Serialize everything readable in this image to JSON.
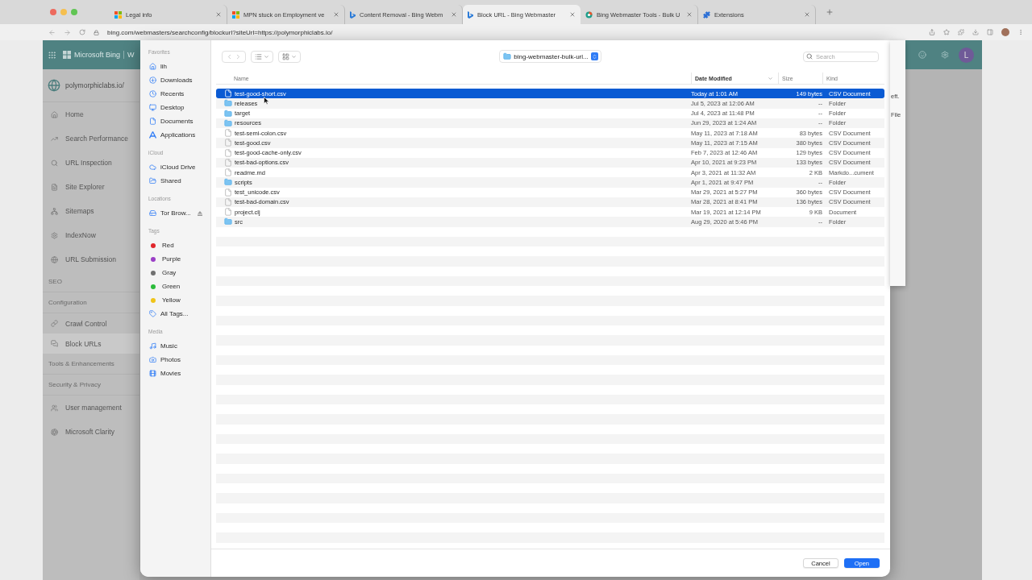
{
  "browser": {
    "tabs": [
      {
        "title": "Legal info",
        "kind": "microsoft",
        "selected": false
      },
      {
        "title": "MPN stuck on Employment ve",
        "kind": "microsoft",
        "selected": false
      },
      {
        "title": "Content Removal - Bing Webm",
        "kind": "bing",
        "selected": false
      },
      {
        "title": "Block URL - Bing Webmaster",
        "kind": "bing",
        "selected": true
      },
      {
        "title": "Bing Webmaster Tools - Bulk U",
        "kind": "webmaster",
        "selected": false
      },
      {
        "title": "Extensions",
        "kind": "extension",
        "selected": false
      }
    ],
    "url": "bing.com/webmasters/searchconfig/blockurl?siteUrl=https://polymorphiclabs.io/"
  },
  "page": {
    "brand": "Microsoft Bing",
    "brand_next": "W",
    "avatar": "L",
    "site": "polymorphiclabs.io/",
    "nav": [
      {
        "label": "Home",
        "kind": "item",
        "selected": false
      },
      {
        "label": "Search Performance",
        "kind": "item",
        "selected": false
      },
      {
        "label": "URL Inspection",
        "kind": "item",
        "selected": false
      },
      {
        "label": "Site Explorer",
        "kind": "item",
        "selected": false
      },
      {
        "label": "Sitemaps",
        "kind": "item",
        "selected": false
      },
      {
        "label": "IndexNow",
        "kind": "item",
        "selected": false
      },
      {
        "label": "URL Submission",
        "kind": "item",
        "selected": false
      },
      {
        "label": "SEO",
        "kind": "section",
        "selected": false
      },
      {
        "label": "Configuration",
        "kind": "section",
        "selected": false
      },
      {
        "label": "Crawl Control",
        "kind": "subitem",
        "selected": false
      },
      {
        "label": "Block URLs",
        "kind": "subitem",
        "selected": true
      },
      {
        "label": "Tools & Enhancements",
        "kind": "section",
        "selected": false
      },
      {
        "label": "Security & Privacy",
        "kind": "section",
        "selected": false
      },
      {
        "label": "User management",
        "kind": "item",
        "selected": false
      },
      {
        "label": "Microsoft Clarity",
        "kind": "item",
        "selected": false
      }
    ],
    "modal_fragments": [
      "eft.",
      "File"
    ]
  },
  "dialog": {
    "sidebar": [
      {
        "heading": "Favorites",
        "items": [
          {
            "label": "lih",
            "kind": "place"
          },
          {
            "label": "Downloads",
            "kind": "place"
          },
          {
            "label": "Recents",
            "kind": "place"
          },
          {
            "label": "Desktop",
            "kind": "place"
          },
          {
            "label": "Documents",
            "kind": "place"
          },
          {
            "label": "Applications",
            "kind": "place"
          }
        ]
      },
      {
        "heading": "iCloud",
        "items": [
          {
            "label": "iCloud Drive",
            "kind": "place"
          },
          {
            "label": "Shared",
            "kind": "place"
          }
        ]
      },
      {
        "heading": "Locations",
        "items": [
          {
            "label": "Tor Brow...",
            "kind": "place",
            "ejectable": true
          }
        ]
      },
      {
        "heading": "Tags",
        "items": [
          {
            "label": "Red",
            "kind": "tag",
            "color": "#e0262b"
          },
          {
            "label": "Purple",
            "kind": "tag",
            "color": "#9a3fc6"
          },
          {
            "label": "Gray",
            "kind": "tag",
            "color": "#707070"
          },
          {
            "label": "Green",
            "kind": "tag",
            "color": "#2bbb3a"
          },
          {
            "label": "Yellow",
            "kind": "tag",
            "color": "#f0c419"
          },
          {
            "label": "All Tags...",
            "kind": "place"
          }
        ]
      },
      {
        "heading": "Media",
        "items": [
          {
            "label": "Music",
            "kind": "place"
          },
          {
            "label": "Photos",
            "kind": "place"
          },
          {
            "label": "Movies",
            "kind": "place"
          }
        ]
      }
    ],
    "location": "bing-webmaster-bulk-url...",
    "search": {
      "placeholder": "Search"
    },
    "columns": [
      {
        "label": "Name",
        "sorted": false
      },
      {
        "label": "Date Modified",
        "sorted": true
      },
      {
        "label": "Size",
        "sorted": false
      },
      {
        "label": "Kind",
        "sorted": false
      }
    ],
    "rows": [
      {
        "name": "test-good-short.csv",
        "kind": "file",
        "date": "Today at 1:01 AM",
        "size": "149 bytes",
        "type": "CSV Document",
        "selected": true
      },
      {
        "name": "releases",
        "kind": "folder",
        "date": "Jul 5, 2023 at 12:06 AM",
        "size": "--",
        "type": "Folder",
        "selected": false
      },
      {
        "name": "target",
        "kind": "folder",
        "date": "Jul 4, 2023 at 11:48 PM",
        "size": "--",
        "type": "Folder",
        "selected": false
      },
      {
        "name": "resources",
        "kind": "folder",
        "date": "Jun 29, 2023 at 1:24 AM",
        "size": "--",
        "type": "Folder",
        "selected": false
      },
      {
        "name": "test-semi-colon.csv",
        "kind": "file",
        "date": "May 11, 2023 at 7:18 AM",
        "size": "83 bytes",
        "type": "CSV Document",
        "selected": false
      },
      {
        "name": "test-good.csv",
        "kind": "file",
        "date": "May 11, 2023 at 7:15 AM",
        "size": "380 bytes",
        "type": "CSV Document",
        "selected": false
      },
      {
        "name": "test-good-cache-only.csv",
        "kind": "file",
        "date": "Feb 7, 2023 at 12:46 AM",
        "size": "129 bytes",
        "type": "CSV Document",
        "selected": false
      },
      {
        "name": "test-bad-options.csv",
        "kind": "file",
        "date": "Apr 10, 2021 at 9:23 PM",
        "size": "133 bytes",
        "type": "CSV Document",
        "selected": false
      },
      {
        "name": "readme.md",
        "kind": "file",
        "date": "Apr 3, 2021 at 11:32 AM",
        "size": "2 KB",
        "type": "Markdo...cument",
        "selected": false
      },
      {
        "name": "scripts",
        "kind": "folder",
        "date": "Apr 1, 2021 at 9:47 PM",
        "size": "--",
        "type": "Folder",
        "selected": false
      },
      {
        "name": "test_unicode.csv",
        "kind": "file",
        "date": "Mar 29, 2021 at 5:27 PM",
        "size": "360 bytes",
        "type": "CSV Document",
        "selected": false
      },
      {
        "name": "test-bad-domain.csv",
        "kind": "file",
        "date": "Mar 28, 2021 at 8:41 PM",
        "size": "136 bytes",
        "type": "CSV Document",
        "selected": false
      },
      {
        "name": "project.clj",
        "kind": "file",
        "date": "Mar 19, 2021 at 12:14 PM",
        "size": "9 KB",
        "type": "Document",
        "selected": false
      },
      {
        "name": "src",
        "kind": "folder",
        "date": "Aug 29, 2020 at 5:46 PM",
        "size": "--",
        "type": "Folder",
        "selected": false
      }
    ],
    "buttons": [
      {
        "label": "Cancel",
        "kind": "secondary"
      },
      {
        "label": "Open",
        "kind": "primary"
      }
    ]
  }
}
